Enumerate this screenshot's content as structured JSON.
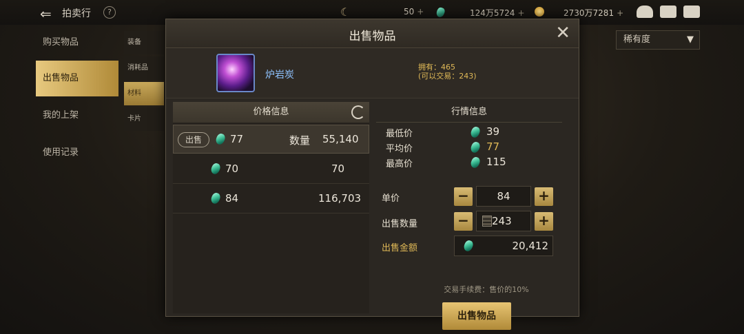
{
  "topbar": {
    "back_icon": "back-arrow-icon",
    "title": "拍卖行",
    "help": "?",
    "moon_amount": "50",
    "gem_amount": "124万5724",
    "coin_amount": "2730万7281",
    "plus": "+"
  },
  "sidebar": {
    "items": [
      {
        "label": "购买物品"
      },
      {
        "label": "出售物品"
      },
      {
        "label": "我的上架"
      },
      {
        "label": "使用记录"
      }
    ]
  },
  "subtabs": [
    {
      "label": "装备"
    },
    {
      "label": "消耗品"
    },
    {
      "label": "材料"
    },
    {
      "label": "卡片"
    }
  ],
  "rarity": {
    "label": "稀有度",
    "arrow": "▼"
  },
  "dialog": {
    "title": "出售物品",
    "close": "✕",
    "item": {
      "name": "炉岩炭",
      "owned": "拥有：465",
      "tradable": "(可以交易：243)"
    },
    "price_panel": {
      "title": "价格信息",
      "rows": [
        {
          "sell_label": "出售",
          "price": "77",
          "qty_label": "数量",
          "qty": "55,140"
        },
        {
          "price": "70",
          "qty": "70"
        },
        {
          "price": "84",
          "qty": "116,703"
        }
      ]
    },
    "market_panel": {
      "title": "行情信息",
      "min_label": "最低价",
      "min": "39",
      "avg_label": "平均价",
      "avg": "77",
      "max_label": "最高价",
      "max": "115"
    },
    "form": {
      "unit_price_label": "单价",
      "unit_price": "84",
      "qty_label": "出售数量",
      "qty": "243",
      "total_label": "出售金额",
      "total": "20,412",
      "minus": "−",
      "plus": "+"
    },
    "fee_text": "交易手续费：售价的10%",
    "sell_button": "出售物品"
  }
}
